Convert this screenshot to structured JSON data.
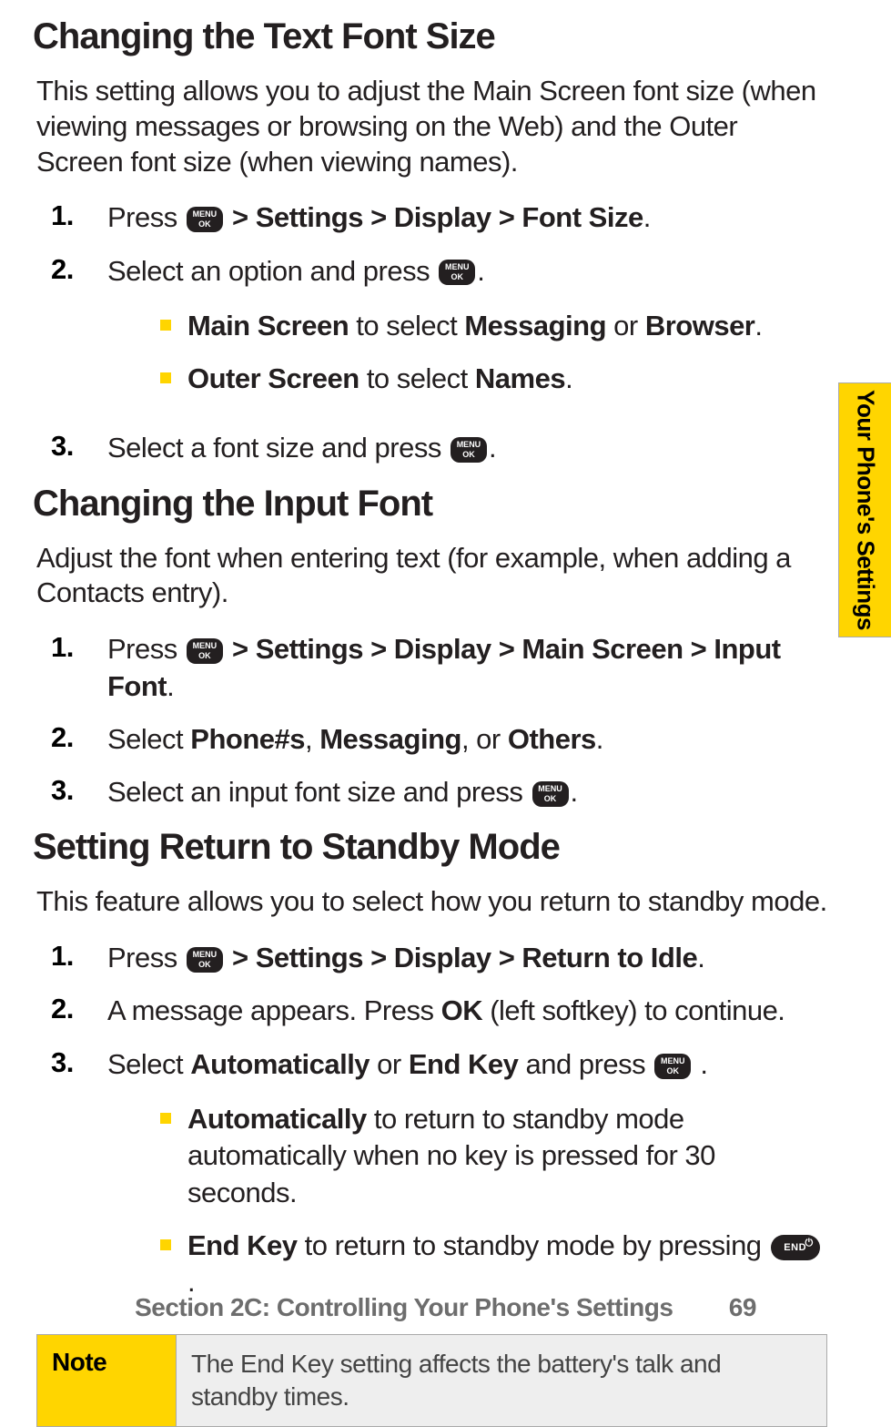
{
  "tab": {
    "label": "Your Phone's Settings"
  },
  "sec1": {
    "heading": "Changing the Text Font Size",
    "intro": "This setting allows you to adjust the Main Screen font size (when viewing messages or browsing on the Web) and the Outer Screen font size (when viewing names).",
    "steps": {
      "n1": "1.",
      "s1_a": "Press ",
      "s1_b": " > Settings > Display > Font Size",
      "s1_c": ".",
      "n2": "2.",
      "s2_a": " Select an option and press ",
      "s2_b": ".",
      "sub_a1": "Main Screen",
      "sub_a2": " to select ",
      "sub_a3": "Messaging",
      "sub_a4": " or ",
      "sub_a5": "Browser",
      "sub_a6": ".",
      "sub_b1": "Outer Screen",
      "sub_b2": " to select ",
      "sub_b3": "Names",
      "sub_b4": ".",
      "n3": "3.",
      "s3_a": "Select a font size and press ",
      "s3_b": "."
    }
  },
  "sec2": {
    "heading": "Changing the Input Font",
    "intro": "Adjust the font when entering text (for example, when adding a Contacts entry).",
    "steps": {
      "n1": "1.",
      "s1_a": "Press ",
      "s1_b": " > Settings > Display > Main Screen > Input Font",
      "s1_c": ".",
      "n2": "2.",
      "s2_a": "Select ",
      "s2_b": "Phone#s",
      "s2_c": ", ",
      "s2_d": "Messaging",
      "s2_e": ", or ",
      "s2_f": "Others",
      "s2_g": ".",
      "n3": "3.",
      "s3_a": "Select an input font size and press ",
      "s3_b": "."
    }
  },
  "sec3": {
    "heading": "Setting Return to Standby Mode",
    "intro": "This feature allows you to select how you return to standby mode.",
    "steps": {
      "n1": "1.",
      "s1_a": "Press ",
      "s1_b": " > Settings > Display > Return to Idle",
      "s1_c": ".",
      "n2": "2.",
      "s2_a": "A message appears. Press ",
      "s2_b": "OK",
      "s2_c": " (left softkey) to continue.",
      "n3": "3.",
      "s3_a": "Select ",
      "s3_b": "Automatically",
      "s3_c": " or ",
      "s3_d": "End Key",
      "s3_e": " and press ",
      "s3_f": " .",
      "sub_a1": "Automatically",
      "sub_a2": " to return to standby mode automatically when no key is pressed for 30 seconds.",
      "sub_b1": "End Key",
      "sub_b2": " to return to standby mode by pressing ",
      "sub_b3": "."
    }
  },
  "note": {
    "label": "Note",
    "body": "The End Key setting affects the battery's talk and standby times."
  },
  "key": {
    "menu": "MENU",
    "ok": "OK",
    "end": "END",
    "power": "⏻"
  },
  "footer": {
    "text": "Section 2C: Controlling Your Phone's Settings",
    "page": "69"
  }
}
